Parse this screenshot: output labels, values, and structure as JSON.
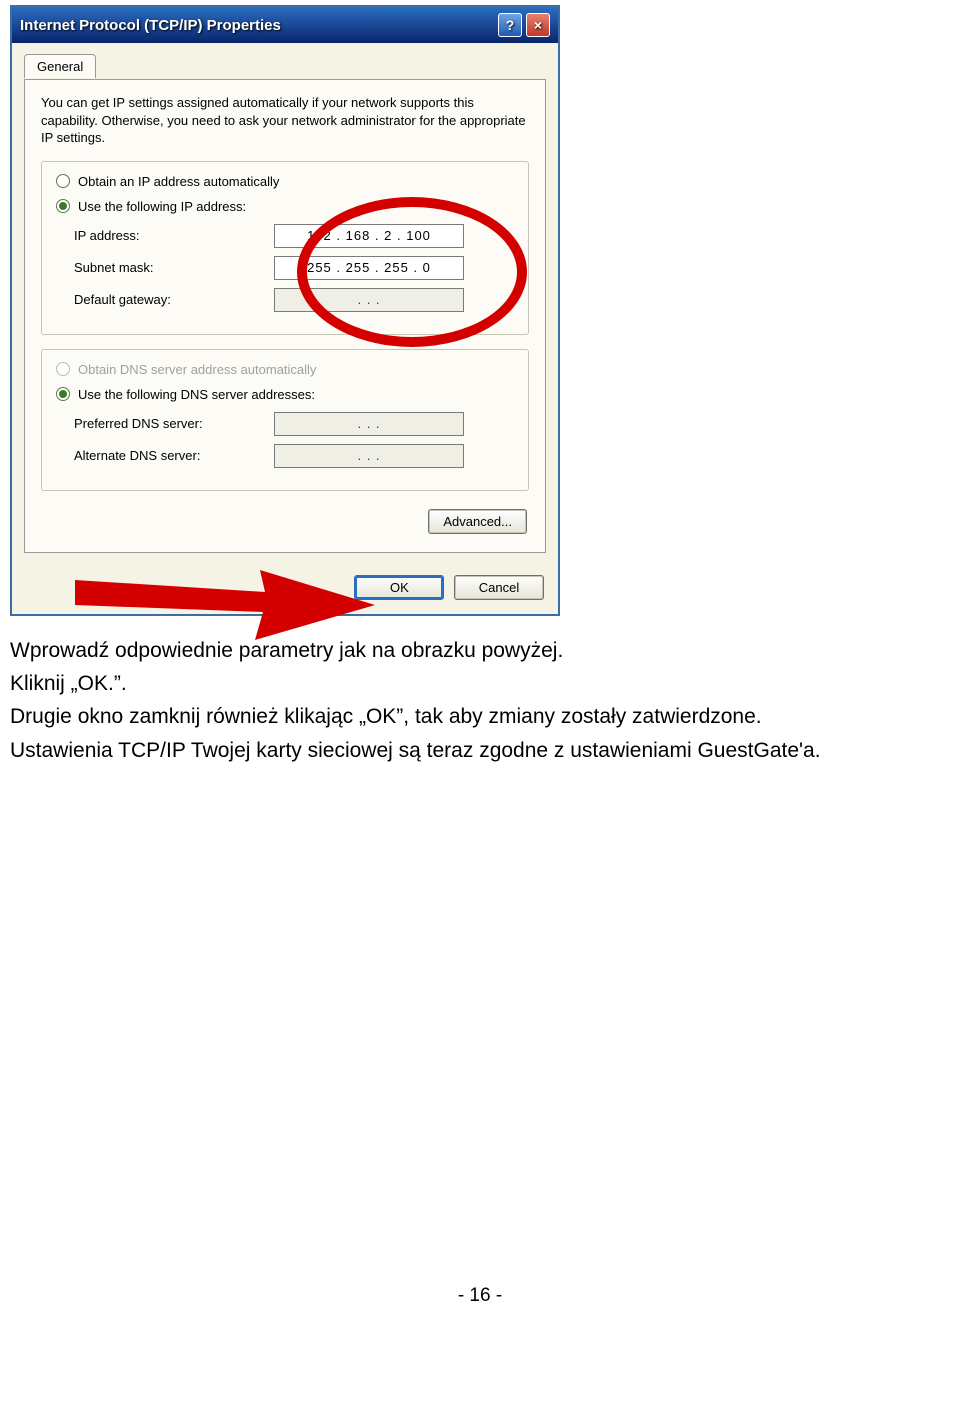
{
  "window": {
    "title": "Internet Protocol (TCP/IP) Properties",
    "tab": "General",
    "intro": "You can get IP settings assigned automatically if your network supports this capability. Otherwise, you need to ask your network administrator for the appropriate IP settings.",
    "ip_group": {
      "radio_auto": "Obtain an IP address automatically",
      "radio_manual": "Use the following IP address:",
      "ip_label": "IP address:",
      "ip_value": "192 . 168 .   2  . 100",
      "subnet_label": "Subnet mask:",
      "subnet_value": "255 . 255 . 255 .   0",
      "gateway_label": "Default gateway:",
      "gateway_value": ".          .          ."
    },
    "dns_group": {
      "radio_auto": "Obtain DNS server address automatically",
      "radio_manual": "Use the following DNS server addresses:",
      "preferred_label": "Preferred DNS server:",
      "preferred_value": ".          .          .",
      "alternate_label": "Alternate DNS server:",
      "alternate_value": ".          .          ."
    },
    "advanced_btn": "Advanced...",
    "ok_btn": "OK",
    "cancel_btn": "Cancel"
  },
  "doc": {
    "line1": "Wprowadź odpowiednie parametry jak na obrazku powyżej.",
    "line2": "Kliknij „OK.”.",
    "line3": "Drugie okno zamknij również klikając „OK”, tak aby zmiany zostały zatwierdzone.",
    "line4": "Ustawienia TCP/IP Twojej karty sieciowej są teraz zgodne z ustawieniami GuestGate'a.",
    "page_number": "- 16 -"
  }
}
